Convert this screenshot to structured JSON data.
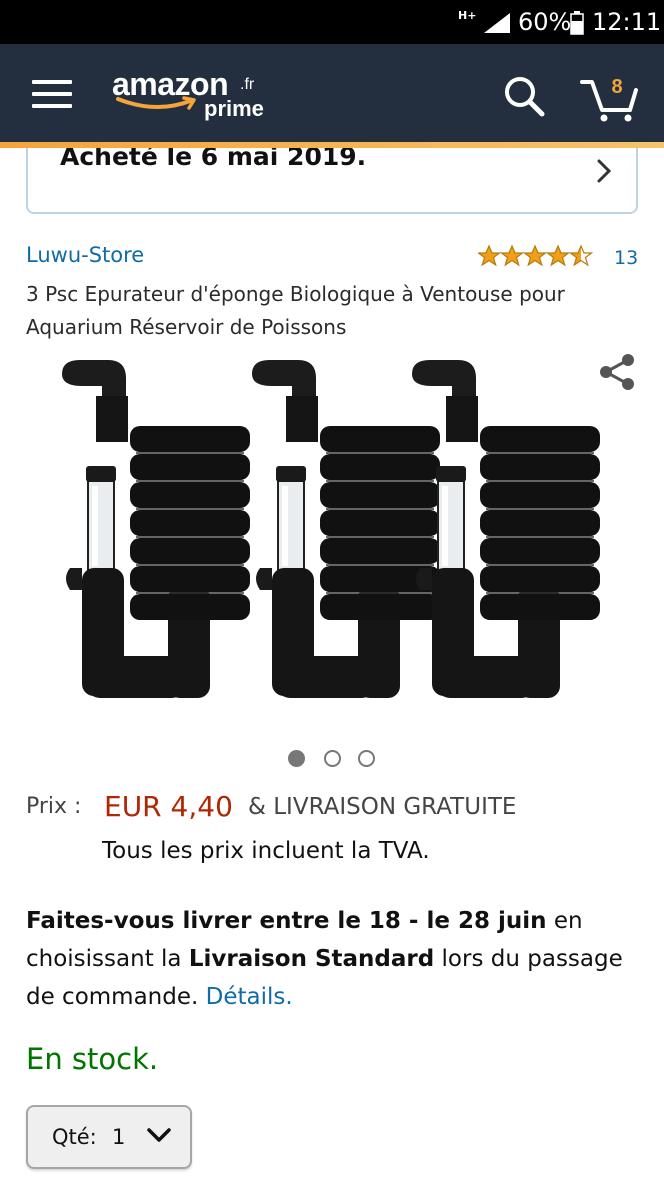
{
  "status_bar": {
    "network": "H+",
    "battery": "60%",
    "time": "12:11"
  },
  "header": {
    "logo_text": "amazon",
    "logo_tld": ".fr",
    "logo_prime": "prime",
    "cart_count": "8",
    "colors": {
      "background": "#232f3e",
      "accent": "#f4a43b"
    }
  },
  "order_card": {
    "text": "Acheté le 6 mai 2019."
  },
  "product": {
    "store": "Luwu-Store",
    "rating_stars": 4.5,
    "rating_count": "13",
    "title": "3 Psc Epurateur d'éponge Biologique à Ventouse pour Aquarium Réservoir de Poissons",
    "image_count": 3,
    "active_image": 1
  },
  "price": {
    "label": "Prix :",
    "value": "EUR 4,40",
    "shipping": "& LIVRAISON GRATUITE",
    "vat_note": "Tous les prix incluent la TVA."
  },
  "delivery": {
    "bold_intro": "Faites-vous livrer entre le 18 - le 28 juin",
    "text1": " en choisissant la ",
    "bold_method": "Livraison Standard",
    "text2": " lors du passage de commande. ",
    "link": "Détails."
  },
  "stock": "En stock.",
  "quantity": {
    "label": "Qté:",
    "value": "1"
  }
}
